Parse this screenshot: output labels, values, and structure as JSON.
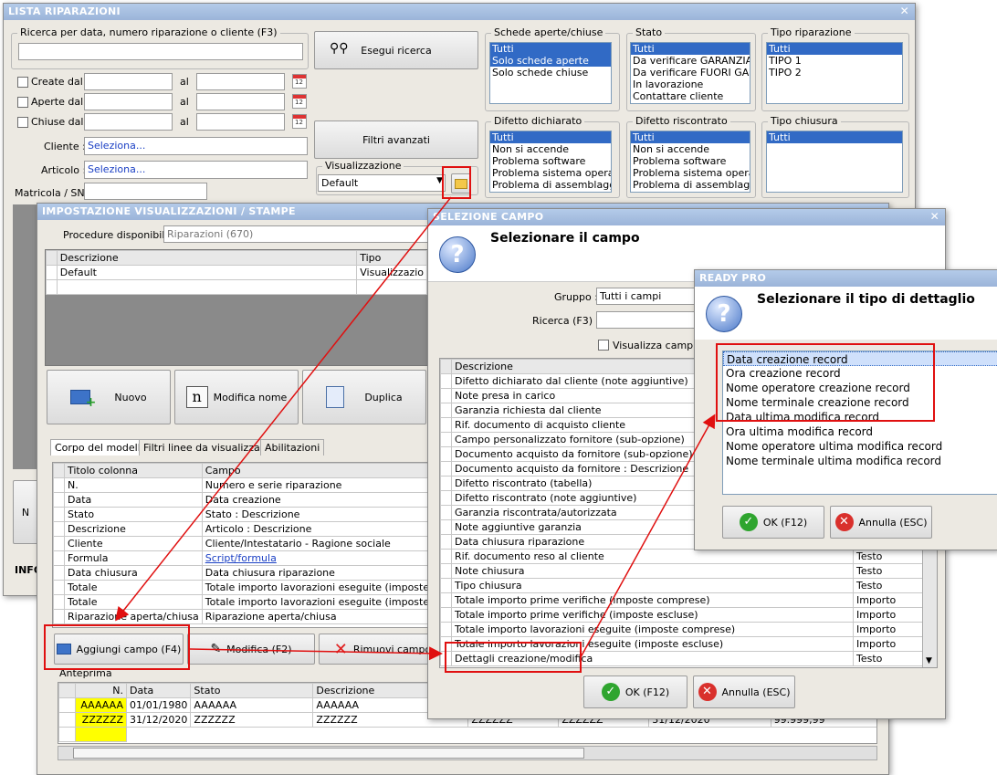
{
  "main": {
    "title": "LISTA RIPARAZIONI",
    "search_group": "Ricerca per data, numero riparazione o cliente (F3)",
    "search_value": "",
    "search_button": "Esegui ricerca",
    "created_label": "Create dal",
    "opened_label": "Aperte dal",
    "closed_label": "Chiuse dal",
    "al_label": "al",
    "cliente_label": "Cliente :",
    "cliente_value": "Seleziona...",
    "articolo_label": "Articolo :",
    "articolo_value": "Seleziona...",
    "matricola_label": "Matricola / SN:",
    "filters_button": "Filtri avanzati",
    "visual_label": "Visualizzazione",
    "visual_value": "Default",
    "schede_title": "Schede aperte/chiuse",
    "schede_items": [
      "Tutti",
      "Solo schede aperte",
      "Solo schede chiuse"
    ],
    "stato_title": "Stato",
    "stato_items": [
      "Tutti",
      "Da verificare GARANZIA",
      "Da verificare FUORI GA",
      "In lavorazione",
      "Contattare cliente"
    ],
    "tipo_rip_title": "Tipo riparazione",
    "tipo_rip_items": [
      "Tutti",
      "TIPO 1",
      "TIPO 2"
    ],
    "difetto_dich_title": "Difetto dichiarato",
    "difetto_dich_items": [
      "Tutti",
      "Non si accende",
      "Problema software",
      "Problema sistema operativo",
      "Problema di assemblaggio"
    ],
    "difetto_risc_title": "Difetto riscontrato",
    "difetto_risc_items": [
      "Tutti",
      "Non si accende",
      "Problema software",
      "Problema sistema operativo",
      "Problema di assemblaggio"
    ],
    "tipo_chiusura_title": "Tipo chiusura",
    "tipo_chiusura_items": [
      "Tutti"
    ],
    "info_label": "INFO",
    "left_button_fragment": "N"
  },
  "impost": {
    "title": "IMPOSTAZIONE VISUALIZZAZIONI / STAMPE",
    "procedure_label": "Procedure disponibili :",
    "procedure_value": "Riparazioni (670)",
    "col_descrizione": "Descrizione",
    "col_tipo": "Tipo",
    "row_desc": "Default",
    "row_tipo": "Visualizzazio",
    "btn_nuovo": "Nuovo",
    "btn_modifica_nome": "Modifica nome",
    "btn_duplica": "Duplica",
    "tabs": [
      "Corpo del modello",
      "Filtri linee da visualizzare",
      "Abilitazioni"
    ],
    "col_titolo": "Titolo colonna",
    "col_campo": "Campo",
    "rows": [
      {
        "t": "N.",
        "c": "Numero e serie riparazione",
        "link": false
      },
      {
        "t": "Data",
        "c": "Data creazione",
        "link": false
      },
      {
        "t": "Stato",
        "c": "Stato : Descrizione",
        "link": false
      },
      {
        "t": "Descrizione",
        "c": "Articolo : Descrizione",
        "link": false
      },
      {
        "t": "Cliente",
        "c": "Cliente/Intestatario - Ragione sociale",
        "link": false
      },
      {
        "t": "Formula",
        "c": "Script/formula",
        "link": true
      },
      {
        "t": "Data chiusura",
        "c": "Data chiusura riparazione",
        "link": false
      },
      {
        "t": "Totale",
        "c": "Totale importo lavorazioni eseguite (imposte comprese)",
        "link": false
      },
      {
        "t": "Totale",
        "c": "Totale importo lavorazioni eseguite (imposte escluse)",
        "link": false
      },
      {
        "t": "Riparazione aperta/chiusa",
        "c": "Riparazione aperta/chiusa",
        "link": false
      }
    ],
    "btn_aggiungi": "Aggiungi campo (F4)",
    "btn_modifica": "Modifica (F2)",
    "btn_rimuovi": "Rimuovi campo",
    "anteprima_label": "Anteprima",
    "prev_headers": [
      "N.",
      "Data",
      "Stato",
      "Descrizione"
    ],
    "prev_rows": [
      [
        "AAAAAA",
        "01/01/1980",
        "AAAAAA",
        "AAAAAA"
      ],
      [
        "ZZZZZZ",
        "31/12/2020",
        "ZZZZZZ",
        "ZZZZZZ"
      ]
    ],
    "prev_tail_frag": [
      "ZZZZZZ",
      "ZZZZZZ",
      "31/12/2020",
      "99.999,99"
    ]
  },
  "selcampo": {
    "title": "SELEZIONE CAMPO",
    "heading": "Selezionare il campo",
    "gruppo_label": "Gruppo :",
    "gruppo_value": "Tutti i campi",
    "ricerca_label": "Ricerca (F3) :",
    "ricerca_value": "",
    "checkbox_label": "Visualizza campi scr",
    "col_descrizione": "Descrizione",
    "rows": [
      {
        "d": "Difetto dichiarato dal cliente (note aggiuntive)",
        "t": ""
      },
      {
        "d": "Note presa in carico",
        "t": ""
      },
      {
        "d": "Garanzia richiesta dal cliente",
        "t": ""
      },
      {
        "d": "Rif. documento di acquisto cliente",
        "t": ""
      },
      {
        "d": "Campo personalizzato fornitore (sub-opzione)",
        "t": ""
      },
      {
        "d": "Documento acquisto da fornitore (sub-opzione)",
        "t": ""
      },
      {
        "d": "Documento acquisto da fornitore : Descrizione",
        "t": ""
      },
      {
        "d": "Difetto riscontrato (tabella)",
        "t": ""
      },
      {
        "d": "Difetto riscontrato (note aggiuntive)",
        "t": ""
      },
      {
        "d": "Garanzia riscontrata/autorizzata",
        "t": ""
      },
      {
        "d": "Note aggiuntive garanzia",
        "t": ""
      },
      {
        "d": "Data chiusura riparazione",
        "t": ""
      },
      {
        "d": "Rif. documento reso al cliente",
        "t": "Testo"
      },
      {
        "d": "Note chiusura",
        "t": "Testo"
      },
      {
        "d": "Tipo chiusura",
        "t": "Testo"
      },
      {
        "d": "Totale importo prime verifiche (imposte comprese)",
        "t": "Importo"
      },
      {
        "d": "Totale importo prime verifiche (imposte escluse)",
        "t": "Importo"
      },
      {
        "d": "Totale importo lavorazioni eseguite (imposte comprese)",
        "t": "Importo"
      },
      {
        "d": "Totale importo lavorazioni eseguite (imposte escluse)",
        "t": "Importo"
      },
      {
        "d": "Dettagli creazione/modifica",
        "t": "Testo"
      }
    ],
    "btn_ok": "OK (F12)",
    "btn_annulla": "Annulla (ESC)"
  },
  "ready": {
    "title": "READY PRO",
    "heading": "Selezionare il tipo di dettaglio",
    "items": [
      "Data creazione record",
      "Ora creazione record",
      "Nome operatore creazione record",
      "Nome terminale creazione record",
      "Data ultima modifica record",
      "Ora ultima modifica record",
      "Nome operatore ultima modifica record",
      "Nome terminale ultima modifica record"
    ],
    "btn_ok": "OK (F12)",
    "btn_annulla": "Annulla (ESC)"
  },
  "colors": {
    "accent": "#316ac5",
    "highlight": "#e01010",
    "yellow": "#ffff00"
  }
}
